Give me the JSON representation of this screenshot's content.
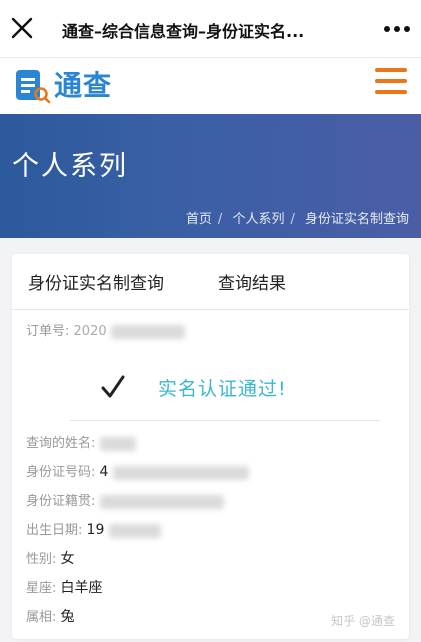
{
  "topbar": {
    "title": "通查–综合信息查询–身份证实名..."
  },
  "brand": {
    "name": "通查"
  },
  "banner": {
    "heading": "个人系列",
    "breadcrumbs": [
      "首页",
      "个人系列",
      "身份证实名制查询"
    ]
  },
  "tabs": {
    "query": "身份证实名制查询",
    "result": "查询结果"
  },
  "order": {
    "label": "订单号:",
    "value": "2020"
  },
  "verify": {
    "message": "实名认证通过!"
  },
  "details": {
    "name_label": "查询的姓名:",
    "id_label": "身份证号码:",
    "id_prefix": "4",
    "origin_label": "身份证籍贯:",
    "birth_label": "出生日期:",
    "birth_prefix": "19",
    "gender_label": "性别:",
    "gender_value": "女",
    "zodiac_label": "星座:",
    "zodiac_value": "白羊座",
    "animal_label": "属相:",
    "animal_value": "兔"
  },
  "watermark": "知乎 @通查",
  "colors": {
    "brand_blue": "#2a86d3",
    "menu_orange": "#e9761a",
    "success_cyan": "#3bb7cf",
    "banner_blue": "#2c5a9c"
  }
}
